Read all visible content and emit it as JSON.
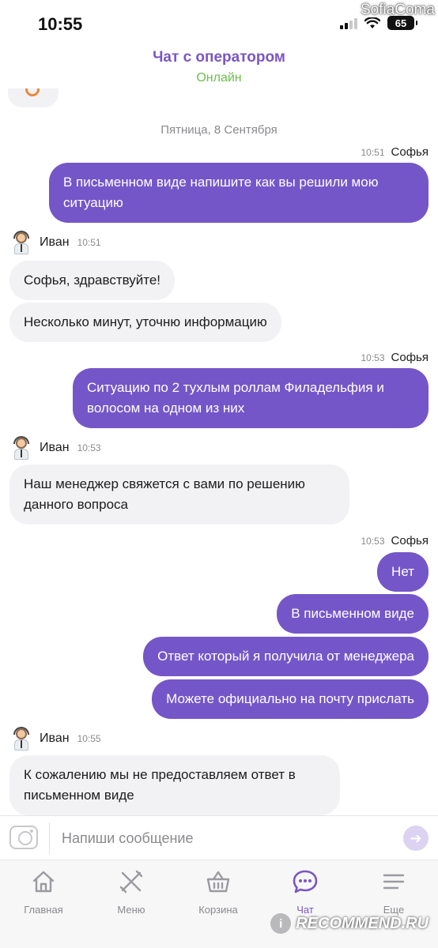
{
  "status_bar": {
    "time": "10:55",
    "battery": "65",
    "watermark_user": "SofiaComa"
  },
  "header": {
    "title": "Чат с оператором",
    "status": "Онлайн"
  },
  "chat": {
    "date": "Пятница, 8 Сентября",
    "groups": [
      {
        "side": "out",
        "name": "Софья",
        "time": "10:51",
        "messages": [
          "В письменном виде напишите как вы решили мою ситуацию"
        ]
      },
      {
        "side": "in",
        "name": "Иван",
        "time": "10:51",
        "messages": [
          "Софья, здравствуйте!",
          "Несколько минут, уточню информацию"
        ]
      },
      {
        "side": "out",
        "name": "Софья",
        "time": "10:53",
        "messages": [
          "Ситуацию по 2 тухлым роллам Филадельфия и волосом на одном из них"
        ]
      },
      {
        "side": "in",
        "name": "Иван",
        "time": "10:53",
        "messages": [
          "Наш менеджер свяжется с вами по решению данного вопроса"
        ]
      },
      {
        "side": "out",
        "name": "Софья",
        "time": "10:53",
        "messages": [
          "Нет",
          "В письменном виде",
          "Ответ который я получила от менеджера",
          "Можете официально на почту прислать"
        ]
      },
      {
        "side": "in",
        "name": "Иван",
        "time": "10:55",
        "messages": [
          "К сожалению мы не предоставляем ответ в письменном виде"
        ]
      }
    ]
  },
  "input": {
    "placeholder": "Напиши сообщение"
  },
  "tabs": [
    {
      "label": "Главная",
      "icon": "home-icon",
      "active": false
    },
    {
      "label": "Меню",
      "icon": "fork-knife-icon",
      "active": false
    },
    {
      "label": "Корзина",
      "icon": "basket-icon",
      "active": false
    },
    {
      "label": "Чат",
      "icon": "chat-icon",
      "active": true
    },
    {
      "label": "Еще",
      "icon": "menu-lines-icon",
      "active": false
    }
  ],
  "colors": {
    "accent": "#7556c8",
    "online": "#6bbf4c",
    "incoming_bubble": "#f2f2f4"
  },
  "footer_watermark": "RECOMMEND.RU"
}
